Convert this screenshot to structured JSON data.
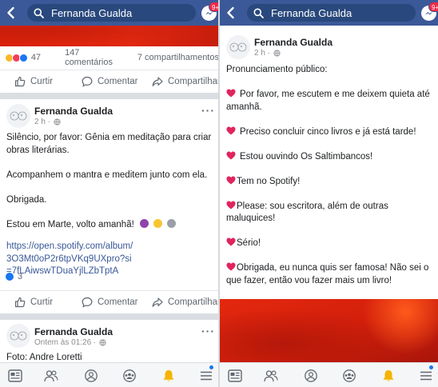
{
  "search": {
    "query": "Fernanda Gualda"
  },
  "messenger": {
    "badge": "9+"
  },
  "colors": {
    "topbar": "#3b5998",
    "link": "#385898",
    "heart": "#e0245e",
    "badge": "#f02849"
  },
  "left": {
    "prev_post": {
      "reaction_count": "47",
      "comments": "147 comentários",
      "shares": "7 compartilhamentos"
    },
    "actions": {
      "like": "Curtir",
      "comment": "Comentar",
      "share": "Compartilhar"
    },
    "post": {
      "author": "Fernanda Gualda",
      "time": "2 h ·",
      "line1": "Silêncio, por favor: Gênia em meditação para criar obras literárias.",
      "line2": "Acompanhem o mantra e meditem junto com ela.",
      "line3": "Obrigada.",
      "line4": "Estou em Marte, volto amanhã!",
      "link": "https://open.spotify.com/album/3O3Mt0oP2r6tpVKq9UXpro?si=7fLAiwswTDuaYjlLZbTptA",
      "likes": "3"
    },
    "next_post": {
      "author": "Fernanda Gualda",
      "time": "Ontem às 01:26 ·",
      "text": "Foto: Andre Loretti"
    }
  },
  "right": {
    "post": {
      "author": "Fernanda Gualda",
      "time": "2 h ·",
      "intro": "Pronunciamento público:",
      "items": [
        "Por favor, me escutem e me deixem quieta até amanhã.",
        "Preciso concluir cinco livros e já está tarde!",
        "Estou ouvindo Os Saltimbancos!",
        "Tem no Spotify!",
        "Please: sou escritora, além de outras maluquices!",
        "Sério!",
        "Obrigada, eu nunca quis ser famosa! Não sei o que fazer, então vou fazer mais um livro!"
      ]
    }
  },
  "icons": {
    "back": "chevron-left-icon",
    "search": "search-icon",
    "messenger": "messenger-icon",
    "nav": [
      "news-feed-icon",
      "friends-icon",
      "profile-icon",
      "groups-icon",
      "notifications-bell-icon",
      "menu-icon"
    ]
  }
}
